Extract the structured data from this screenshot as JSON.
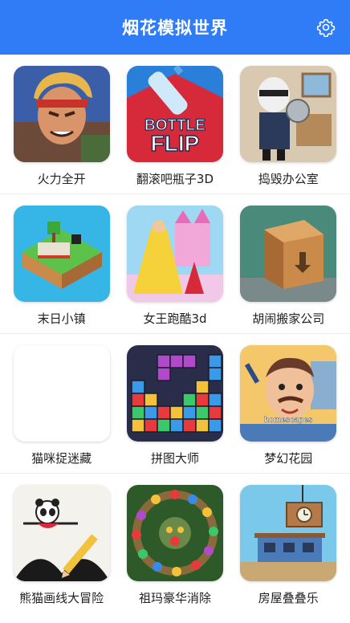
{
  "header": {
    "title": "烟花模拟世界"
  },
  "games": [
    {
      "label": "火力全开"
    },
    {
      "label": "翻滚吧瓶子3D",
      "icon_text_1": "BOTTLE",
      "icon_text_2": "FLIP"
    },
    {
      "label": "捣毁办公室"
    },
    {
      "label": "末日小镇"
    },
    {
      "label": "女王跑酷3d"
    },
    {
      "label": "胡闹搬家公司"
    },
    {
      "label": "猫咪捉迷藏"
    },
    {
      "label": "拼图大师"
    },
    {
      "label": "梦幻花园",
      "icon_text_1": "homescapes"
    },
    {
      "label": "熊猫画线大冒险"
    },
    {
      "label": "祖玛豪华消除"
    },
    {
      "label": "房屋叠叠乐"
    }
  ],
  "colors": {
    "header_bg": "#2f7cf6",
    "text": "#222222",
    "divider": "#ececec"
  }
}
